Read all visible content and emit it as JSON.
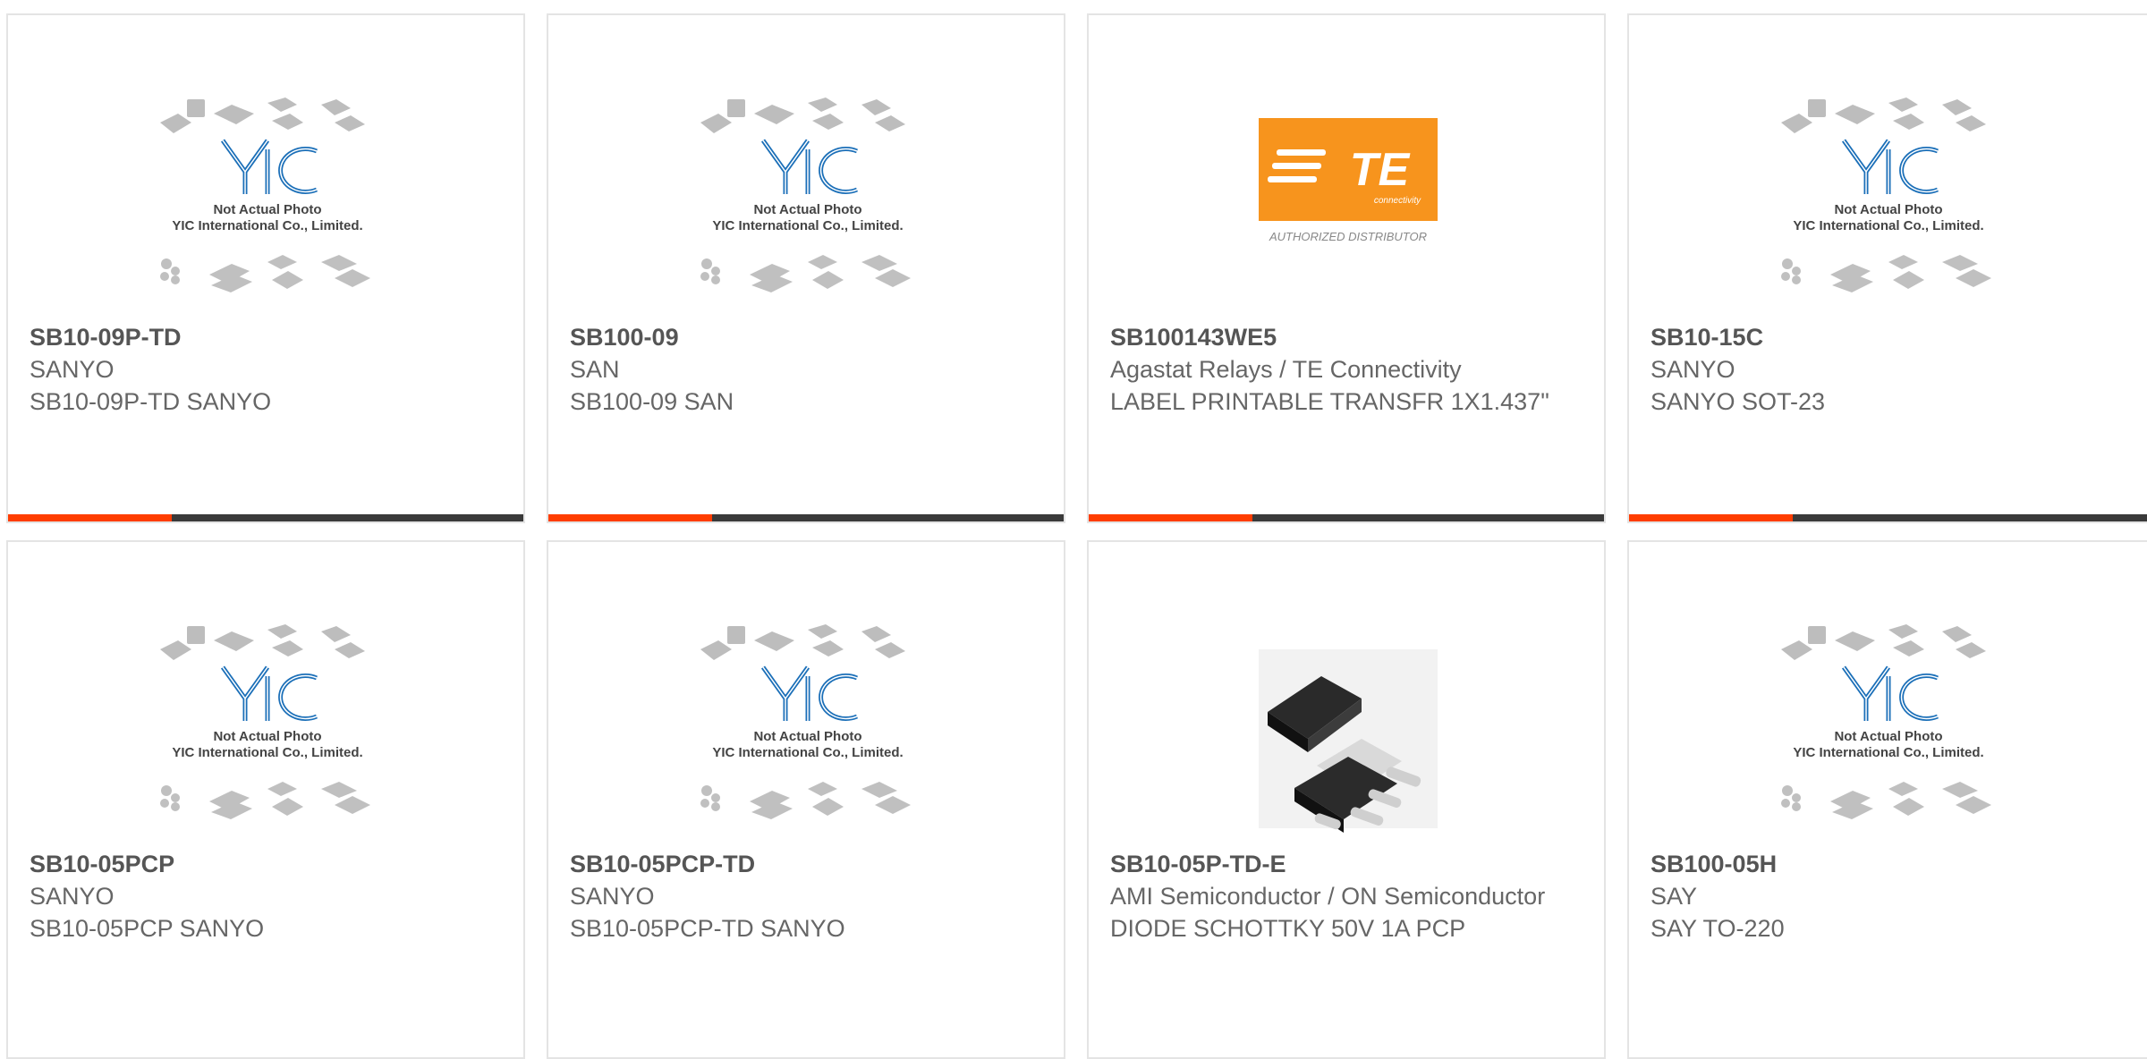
{
  "placeholder_image": {
    "caption_line1": "Not Actual Photo",
    "caption_line2": "YIC International Co., Limited.",
    "logo_text": "YIC"
  },
  "te_logo": {
    "brand": "TE",
    "sub": "connectivity",
    "tagline": "AUTHORIZED DISTRIBUTOR",
    "color": "#f7941d"
  },
  "colors": {
    "accent": "#ff3d00",
    "bar": "#3a3a3a",
    "yic_blue": "#1b6fb8"
  },
  "products": [
    {
      "part": "SB10-09P-TD",
      "manufacturer": "SANYO",
      "description": "SB10-09P-TD SANYO",
      "image": "placeholder"
    },
    {
      "part": "SB100-09",
      "manufacturer": "SAN",
      "description": "SB100-09 SAN",
      "image": "placeholder"
    },
    {
      "part": "SB100143WE5",
      "manufacturer": "Agastat Relays / TE Connectivity",
      "description": "LABEL PRINTABLE TRANSFR 1X1.437\"",
      "image": "te-logo"
    },
    {
      "part": "SB10-15C",
      "manufacturer": "SANYO",
      "description": "SANYO SOT-23",
      "image": "placeholder"
    },
    {
      "part": "SB10-05PCP",
      "manufacturer": "SANYO",
      "description": "SB10-05PCP SANYO",
      "image": "placeholder"
    },
    {
      "part": "SB10-05PCP-TD",
      "manufacturer": "SANYO",
      "description": "SB10-05PCP-TD SANYO",
      "image": "placeholder"
    },
    {
      "part": "SB10-05P-TD-E",
      "manufacturer": "AMI Semiconductor / ON Semiconductor",
      "description": "DIODE SCHOTTKY 50V 1A PCP",
      "image": "chip-photo"
    },
    {
      "part": "SB100-05H",
      "manufacturer": "SAY",
      "description": "SAY TO-220",
      "image": "placeholder"
    }
  ]
}
